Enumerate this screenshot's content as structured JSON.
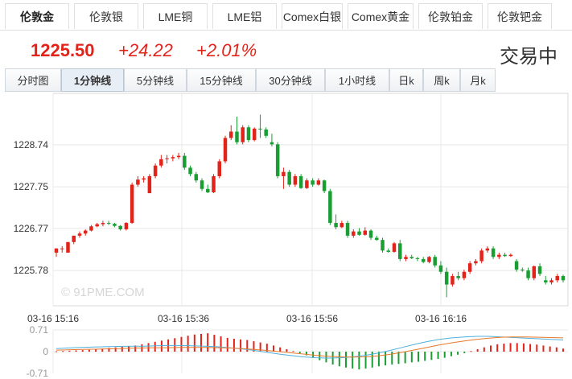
{
  "tabs": [
    "伦敦金",
    "伦敦银",
    "LME铜",
    "LME铝",
    "Comex白银",
    "Comex黄金",
    "伦敦铂金",
    "伦敦钯金"
  ],
  "active_tab": 0,
  "quote": {
    "price": "1225.50",
    "change": "+24.22",
    "change_pct": "+2.01%",
    "status": "交易中"
  },
  "periods": [
    "分时图",
    "1分钟线",
    "5分钟线",
    "15分钟线",
    "30分钟线",
    "1小时线",
    "日k",
    "周k",
    "月k"
  ],
  "active_period": 1,
  "colors": {
    "up": "#e2231a",
    "down": "#1a9e34",
    "grid": "#e8e8e8",
    "macd_line1": "#4fb0dc",
    "macd_line2": "#e8782a"
  },
  "watermark": "© 91PME.COM",
  "chart_data": [
    {
      "type": "candlestick",
      "y_ticks": [
        "1228.74",
        "1227.75",
        "1226.77",
        "1225.78"
      ],
      "x_ticks": [
        "03-16 15:16",
        "03-16 15:36",
        "03-16 15:56",
        "03-16 16:16"
      ],
      "ylim": [
        1224.9,
        1229.9
      ],
      "grid": true,
      "candles": [
        [
          1226.2,
          1226.3,
          1226.1,
          1226.3
        ],
        [
          1226.3,
          1226.35,
          1226.2,
          1226.3
        ],
        [
          1226.2,
          1226.45,
          1226.2,
          1226.45
        ],
        [
          1226.45,
          1226.6,
          1226.4,
          1226.6
        ],
        [
          1226.6,
          1226.7,
          1226.55,
          1226.65
        ],
        [
          1226.65,
          1226.75,
          1226.6,
          1226.72
        ],
        [
          1226.72,
          1226.85,
          1226.7,
          1226.82
        ],
        [
          1226.82,
          1226.9,
          1226.8,
          1226.87
        ],
        [
          1226.87,
          1226.95,
          1226.82,
          1226.9
        ],
        [
          1226.9,
          1226.95,
          1226.85,
          1226.88
        ],
        [
          1226.88,
          1226.9,
          1226.8,
          1226.83
        ],
        [
          1226.83,
          1226.85,
          1226.72,
          1226.75
        ],
        [
          1226.75,
          1226.92,
          1226.72,
          1226.9
        ],
        [
          1226.9,
          1227.85,
          1226.88,
          1227.8
        ],
        [
          1227.8,
          1228.0,
          1227.75,
          1227.92
        ],
        [
          1227.92,
          1228.0,
          1227.85,
          1227.95
        ],
        [
          1227.6,
          1228.05,
          1227.6,
          1228.0
        ],
        [
          1228.0,
          1228.3,
          1227.95,
          1228.25
        ],
        [
          1228.25,
          1228.5,
          1228.2,
          1228.4
        ],
        [
          1228.4,
          1228.5,
          1228.3,
          1228.42
        ],
        [
          1228.42,
          1228.5,
          1228.35,
          1228.45
        ],
        [
          1228.45,
          1228.55,
          1228.4,
          1228.48
        ],
        [
          1228.48,
          1228.55,
          1228.15,
          1228.2
        ],
        [
          1228.2,
          1228.25,
          1228.0,
          1228.05
        ],
        [
          1228.05,
          1228.1,
          1227.85,
          1227.9
        ],
        [
          1227.9,
          1227.95,
          1227.65,
          1227.7
        ],
        [
          1227.7,
          1227.8,
          1227.6,
          1227.62
        ],
        [
          1227.62,
          1228.05,
          1227.6,
          1228.0
        ],
        [
          1228.0,
          1228.4,
          1227.95,
          1228.35
        ],
        [
          1228.35,
          1228.95,
          1228.3,
          1228.9
        ],
        [
          1228.9,
          1229.2,
          1228.85,
          1229.05
        ],
        [
          1229.05,
          1229.4,
          1228.75,
          1228.8
        ],
        [
          1228.8,
          1229.2,
          1228.75,
          1229.15
        ],
        [
          1229.15,
          1229.2,
          1228.8,
          1228.85
        ],
        [
          1228.85,
          1229.15,
          1228.82,
          1229.12
        ],
        [
          1229.12,
          1229.45,
          1228.9,
          1229.1
        ],
        [
          1229.1,
          1229.15,
          1228.9,
          1228.95
        ],
        [
          1228.8,
          1229.0,
          1228.7,
          1228.75
        ],
        [
          1228.75,
          1228.8,
          1227.95,
          1228.0
        ],
        [
          1228.0,
          1228.2,
          1227.7,
          1228.1
        ],
        [
          1228.1,
          1228.15,
          1227.75,
          1227.8
        ],
        [
          1227.8,
          1228.05,
          1227.75,
          1228.0
        ],
        [
          1228.0,
          1228.05,
          1227.7,
          1227.72
        ],
        [
          1227.72,
          1227.95,
          1227.7,
          1227.9
        ],
        [
          1227.9,
          1227.95,
          1227.75,
          1227.8
        ],
        [
          1227.8,
          1227.95,
          1227.78,
          1227.9
        ],
        [
          1227.9,
          1227.92,
          1227.6,
          1227.65
        ],
        [
          1227.65,
          1227.7,
          1226.85,
          1226.9
        ],
        [
          1226.9,
          1227.1,
          1226.75,
          1226.8
        ],
        [
          1226.8,
          1226.95,
          1226.78,
          1226.9
        ],
        [
          1226.9,
          1226.95,
          1226.55,
          1226.6
        ],
        [
          1226.6,
          1226.75,
          1226.55,
          1226.7
        ],
        [
          1226.7,
          1226.78,
          1226.6,
          1226.62
        ],
        [
          1226.62,
          1226.8,
          1226.6,
          1226.72
        ],
        [
          1226.72,
          1226.75,
          1226.5,
          1226.55
        ],
        [
          1226.55,
          1226.6,
          1226.48,
          1226.5
        ],
        [
          1226.5,
          1226.55,
          1226.2,
          1226.25
        ],
        [
          1226.25,
          1226.3,
          1226.2,
          1226.22
        ],
        [
          1226.22,
          1226.45,
          1226.2,
          1226.42
        ],
        [
          1226.42,
          1226.5,
          1226.0,
          1226.05
        ],
        [
          1226.05,
          1226.15,
          1226.0,
          1226.1
        ],
        [
          1226.1,
          1226.15,
          1226.05,
          1226.07
        ],
        [
          1226.07,
          1226.1,
          1226.0,
          1226.05
        ],
        [
          1226.05,
          1226.1,
          1225.95,
          1225.98
        ],
        [
          1225.98,
          1226.12,
          1225.95,
          1226.1
        ],
        [
          1226.1,
          1226.15,
          1225.85,
          1225.9
        ],
        [
          1225.9,
          1226.0,
          1225.7,
          1225.75
        ],
        [
          1225.75,
          1225.85,
          1225.15,
          1225.45
        ],
        [
          1225.45,
          1225.7,
          1225.4,
          1225.65
        ],
        [
          1225.65,
          1225.75,
          1225.55,
          1225.6
        ],
        [
          1225.6,
          1225.8,
          1225.55,
          1225.75
        ],
        [
          1225.75,
          1226.0,
          1225.7,
          1225.95
        ],
        [
          1225.95,
          1226.05,
          1225.9,
          1226.0
        ],
        [
          1226.0,
          1226.3,
          1225.95,
          1226.25
        ],
        [
          1226.25,
          1226.35,
          1226.2,
          1226.3
        ],
        [
          1226.3,
          1226.35,
          1226.05,
          1226.1
        ],
        [
          1226.1,
          1226.2,
          1226.05,
          1226.15
        ],
        [
          1226.15,
          1226.2,
          1226.1,
          1226.12
        ],
        [
          1226.12,
          1226.18,
          1226.1,
          1226.15
        ],
        [
          1226.0,
          1226.05,
          1225.75,
          1225.8
        ],
        [
          1225.8,
          1225.85,
          1225.75,
          1225.78
        ],
        [
          1225.78,
          1225.85,
          1225.55,
          1225.6
        ],
        [
          1225.6,
          1225.9,
          1225.55,
          1225.88
        ],
        [
          1225.88,
          1225.95,
          1225.65,
          1225.7
        ],
        [
          1225.55,
          1225.65,
          1225.45,
          1225.5
        ],
        [
          1225.5,
          1225.6,
          1225.45,
          1225.55
        ],
        [
          1225.55,
          1225.7,
          1225.5,
          1225.65
        ],
        [
          1225.65,
          1225.68,
          1225.5,
          1225.55
        ]
      ]
    },
    {
      "type": "macd",
      "y_ticks": [
        "0.71",
        "0",
        "-0.71"
      ],
      "ylim": [
        -0.71,
        0.71
      ],
      "bars": [
        0.01,
        0.02,
        0.03,
        0.04,
        0.05,
        0.06,
        0.08,
        0.1,
        0.12,
        0.14,
        0.16,
        0.18,
        0.2,
        0.24,
        0.28,
        0.32,
        0.36,
        0.4,
        0.44,
        0.48,
        0.52,
        0.56,
        0.58,
        0.6,
        0.55,
        0.5,
        0.45,
        0.42,
        0.4,
        0.38,
        0.34,
        0.3,
        0.26,
        0.2,
        0.14,
        0.08,
        0.02,
        -0.05,
        -0.12,
        -0.2,
        -0.28,
        -0.35,
        -0.42,
        -0.48,
        -0.52,
        -0.55,
        -0.58,
        -0.55,
        -0.52,
        -0.48,
        -0.45,
        -0.42,
        -0.4,
        -0.38,
        -0.35,
        -0.33,
        -0.3,
        -0.27,
        -0.24,
        -0.2,
        -0.15,
        -0.1,
        -0.05,
        0.02,
        0.08,
        0.14,
        0.2,
        0.24,
        0.26,
        0.28,
        0.28,
        0.27,
        0.25,
        0.23,
        0.2,
        0.17,
        0.14,
        0.1
      ],
      "dif": [
        0.1,
        0.12,
        0.14,
        0.15,
        0.16,
        0.17,
        0.18,
        0.18,
        0.19,
        0.2,
        0.2,
        0.19,
        0.18,
        0.16,
        0.13,
        0.09,
        0.04,
        -0.02,
        -0.08,
        -0.13,
        -0.17,
        -0.2,
        -0.21,
        -0.2,
        -0.17,
        -0.12,
        -0.05,
        0.04,
        0.14,
        0.24,
        0.33,
        0.4,
        0.45,
        0.48,
        0.5,
        0.5,
        0.48,
        0.46,
        0.44,
        0.42,
        0.4,
        0.38
      ],
      "dea": [
        0.05,
        0.06,
        0.07,
        0.08,
        0.09,
        0.1,
        0.11,
        0.12,
        0.13,
        0.13,
        0.14,
        0.14,
        0.14,
        0.13,
        0.12,
        0.1,
        0.07,
        0.04,
        0.0,
        -0.04,
        -0.08,
        -0.12,
        -0.15,
        -0.17,
        -0.18,
        -0.17,
        -0.14,
        -0.09,
        -0.02,
        0.06,
        0.14,
        0.22,
        0.29,
        0.35,
        0.4,
        0.44,
        0.47,
        0.48,
        0.48,
        0.47,
        0.46,
        0.45
      ]
    }
  ]
}
